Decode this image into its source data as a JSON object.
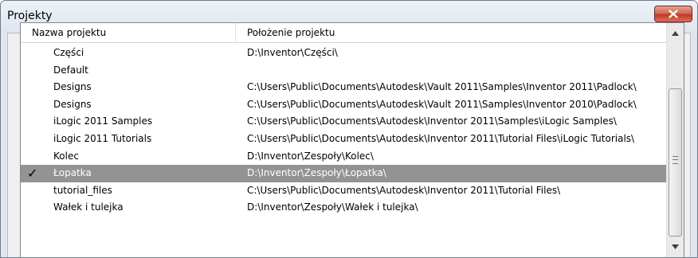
{
  "window": {
    "title": "Projekty",
    "close_label": "X"
  },
  "list": {
    "columns": [
      "Nazwa projektu",
      "Położenie projektu"
    ],
    "rows": [
      {
        "name": "Części",
        "path": "D:\\Inventor\\Części\\",
        "active": false
      },
      {
        "name": "Default",
        "path": "",
        "active": false
      },
      {
        "name": "Designs",
        "path": "C:\\Users\\Public\\Documents\\Autodesk\\Vault 2011\\Samples\\Inventor 2011\\Padlock\\",
        "active": false
      },
      {
        "name": "Designs",
        "path": "C:\\Users\\Public\\Documents\\Autodesk\\Vault 2011\\Samples\\Inventor 2010\\Padlock\\",
        "active": false
      },
      {
        "name": "iLogic 2011 Samples",
        "path": "C:\\Users\\Public\\Documents\\Autodesk\\Inventor 2011\\Samples\\iLogic Samples\\",
        "active": false
      },
      {
        "name": "iLogic 2011 Tutorials",
        "path": "C:\\Users\\Public\\Documents\\Autodesk\\Inventor 2011\\Tutorial Files\\iLogic Tutorials\\",
        "active": false
      },
      {
        "name": "Kolec",
        "path": "D:\\Inventor\\Zespoły\\Kolec\\",
        "active": false
      },
      {
        "name": "Łopatka",
        "path": "D:\\Inventor\\Zespoły\\Łopatka\\",
        "active": true
      },
      {
        "name": "tutorial_files",
        "path": "C:\\Users\\Public\\Documents\\Autodesk\\Inventor 2011\\Tutorial Files\\",
        "active": false
      },
      {
        "name": "Wałek i tulejka",
        "path": "D:\\Inventor\\Zespoły\\Wałek i tulejka\\",
        "active": false
      }
    ],
    "active_marker": "✓"
  },
  "colors": {
    "selected_row": "#939393",
    "close_button": "#c0392b"
  }
}
